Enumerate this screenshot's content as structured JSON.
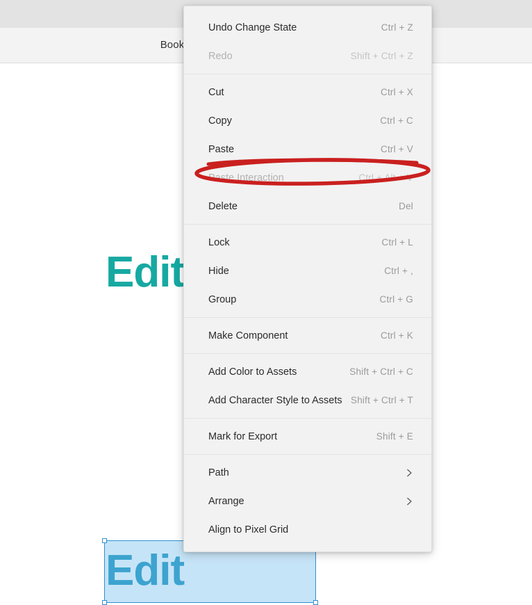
{
  "app": {
    "toolbar": {
      "title": "Book"
    }
  },
  "canvas": {
    "primary_text": "Edit",
    "selected_text": "Edit",
    "teal_color": "#16a9a2",
    "selection_blue": "#2f8fd0",
    "selected_text_color": "#1390ba"
  },
  "context_menu": {
    "groups": [
      {
        "items": [
          {
            "label": "Undo Change State",
            "shortcut": "Ctrl + Z",
            "disabled": false,
            "submenu": false
          },
          {
            "label": "Redo",
            "shortcut": "Shift + Ctrl + Z",
            "disabled": true,
            "submenu": false
          }
        ]
      },
      {
        "items": [
          {
            "label": "Cut",
            "shortcut": "Ctrl + X",
            "disabled": false,
            "submenu": false
          },
          {
            "label": "Copy",
            "shortcut": "Ctrl + C",
            "disabled": false,
            "submenu": false
          },
          {
            "label": "Paste",
            "shortcut": "Ctrl + V",
            "disabled": false,
            "submenu": false
          },
          {
            "label": "Paste Interaction",
            "shortcut": "Ctrl + Alt + V",
            "disabled": true,
            "submenu": false
          },
          {
            "label": "Delete",
            "shortcut": "Del",
            "disabled": false,
            "submenu": false
          }
        ]
      },
      {
        "items": [
          {
            "label": "Lock",
            "shortcut": "Ctrl + L",
            "disabled": false,
            "submenu": false
          },
          {
            "label": "Hide",
            "shortcut": "Ctrl + ,",
            "disabled": false,
            "submenu": false
          },
          {
            "label": "Group",
            "shortcut": "Ctrl + G",
            "disabled": false,
            "submenu": false
          }
        ]
      },
      {
        "items": [
          {
            "label": "Make Component",
            "shortcut": "Ctrl + K",
            "disabled": false,
            "submenu": false
          }
        ]
      },
      {
        "items": [
          {
            "label": "Add Color to Assets",
            "shortcut": "Shift + Ctrl + C",
            "disabled": false,
            "submenu": false
          },
          {
            "label": "Add Character Style to Assets",
            "shortcut": "Shift + Ctrl + T",
            "disabled": false,
            "submenu": false
          }
        ]
      },
      {
        "items": [
          {
            "label": "Mark for Export",
            "shortcut": "Shift + E",
            "disabled": false,
            "submenu": false
          }
        ]
      },
      {
        "items": [
          {
            "label": "Path",
            "shortcut": "",
            "disabled": false,
            "submenu": true
          },
          {
            "label": "Arrange",
            "shortcut": "",
            "disabled": false,
            "submenu": true
          },
          {
            "label": "Align to Pixel Grid",
            "shortcut": "",
            "disabled": false,
            "submenu": false
          }
        ]
      }
    ]
  },
  "annotation": {
    "color": "#c9201f",
    "target_label": "Paste Interaction"
  }
}
